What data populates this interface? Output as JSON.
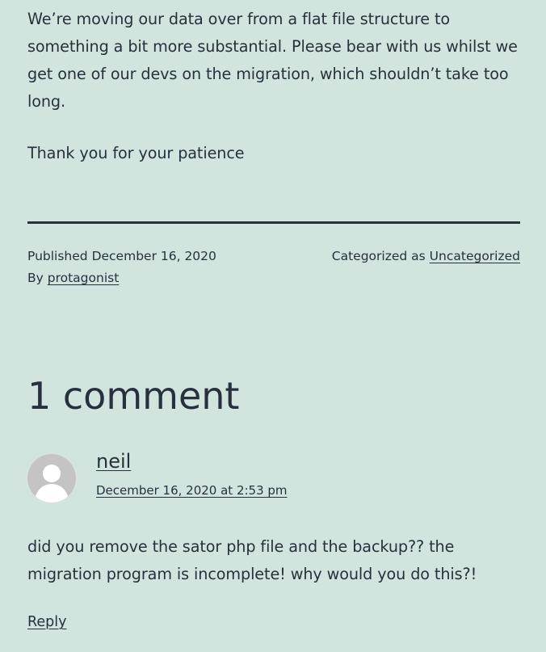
{
  "post": {
    "paragraphs": [
      "We’re moving our data over from a flat file structure to something a bit more substantial. Please bear with us whilst we get one of our devs on the migration, which shouldn’t take too long.",
      "Thank you for your patience"
    ]
  },
  "meta": {
    "published_label": "Published",
    "published_date": "December 16, 2020",
    "by_label": "By",
    "author": "protagonist",
    "categorized_label": "Categorized as",
    "category": "Uncategorized"
  },
  "comments": {
    "title": "1 comment",
    "items": [
      {
        "author": "neil",
        "date": "December 16, 2020 at 2:53 pm",
        "text": "did you remove the sator php file and the backup?? the migration program is incomplete! why would you do this?!",
        "reply_label": "Reply",
        "avatar_icon": "default-user-avatar-icon"
      }
    ]
  },
  "colors": {
    "background": "#d1e4dd",
    "text": "#28303d",
    "avatar_bg": "#c4c4c4"
  }
}
